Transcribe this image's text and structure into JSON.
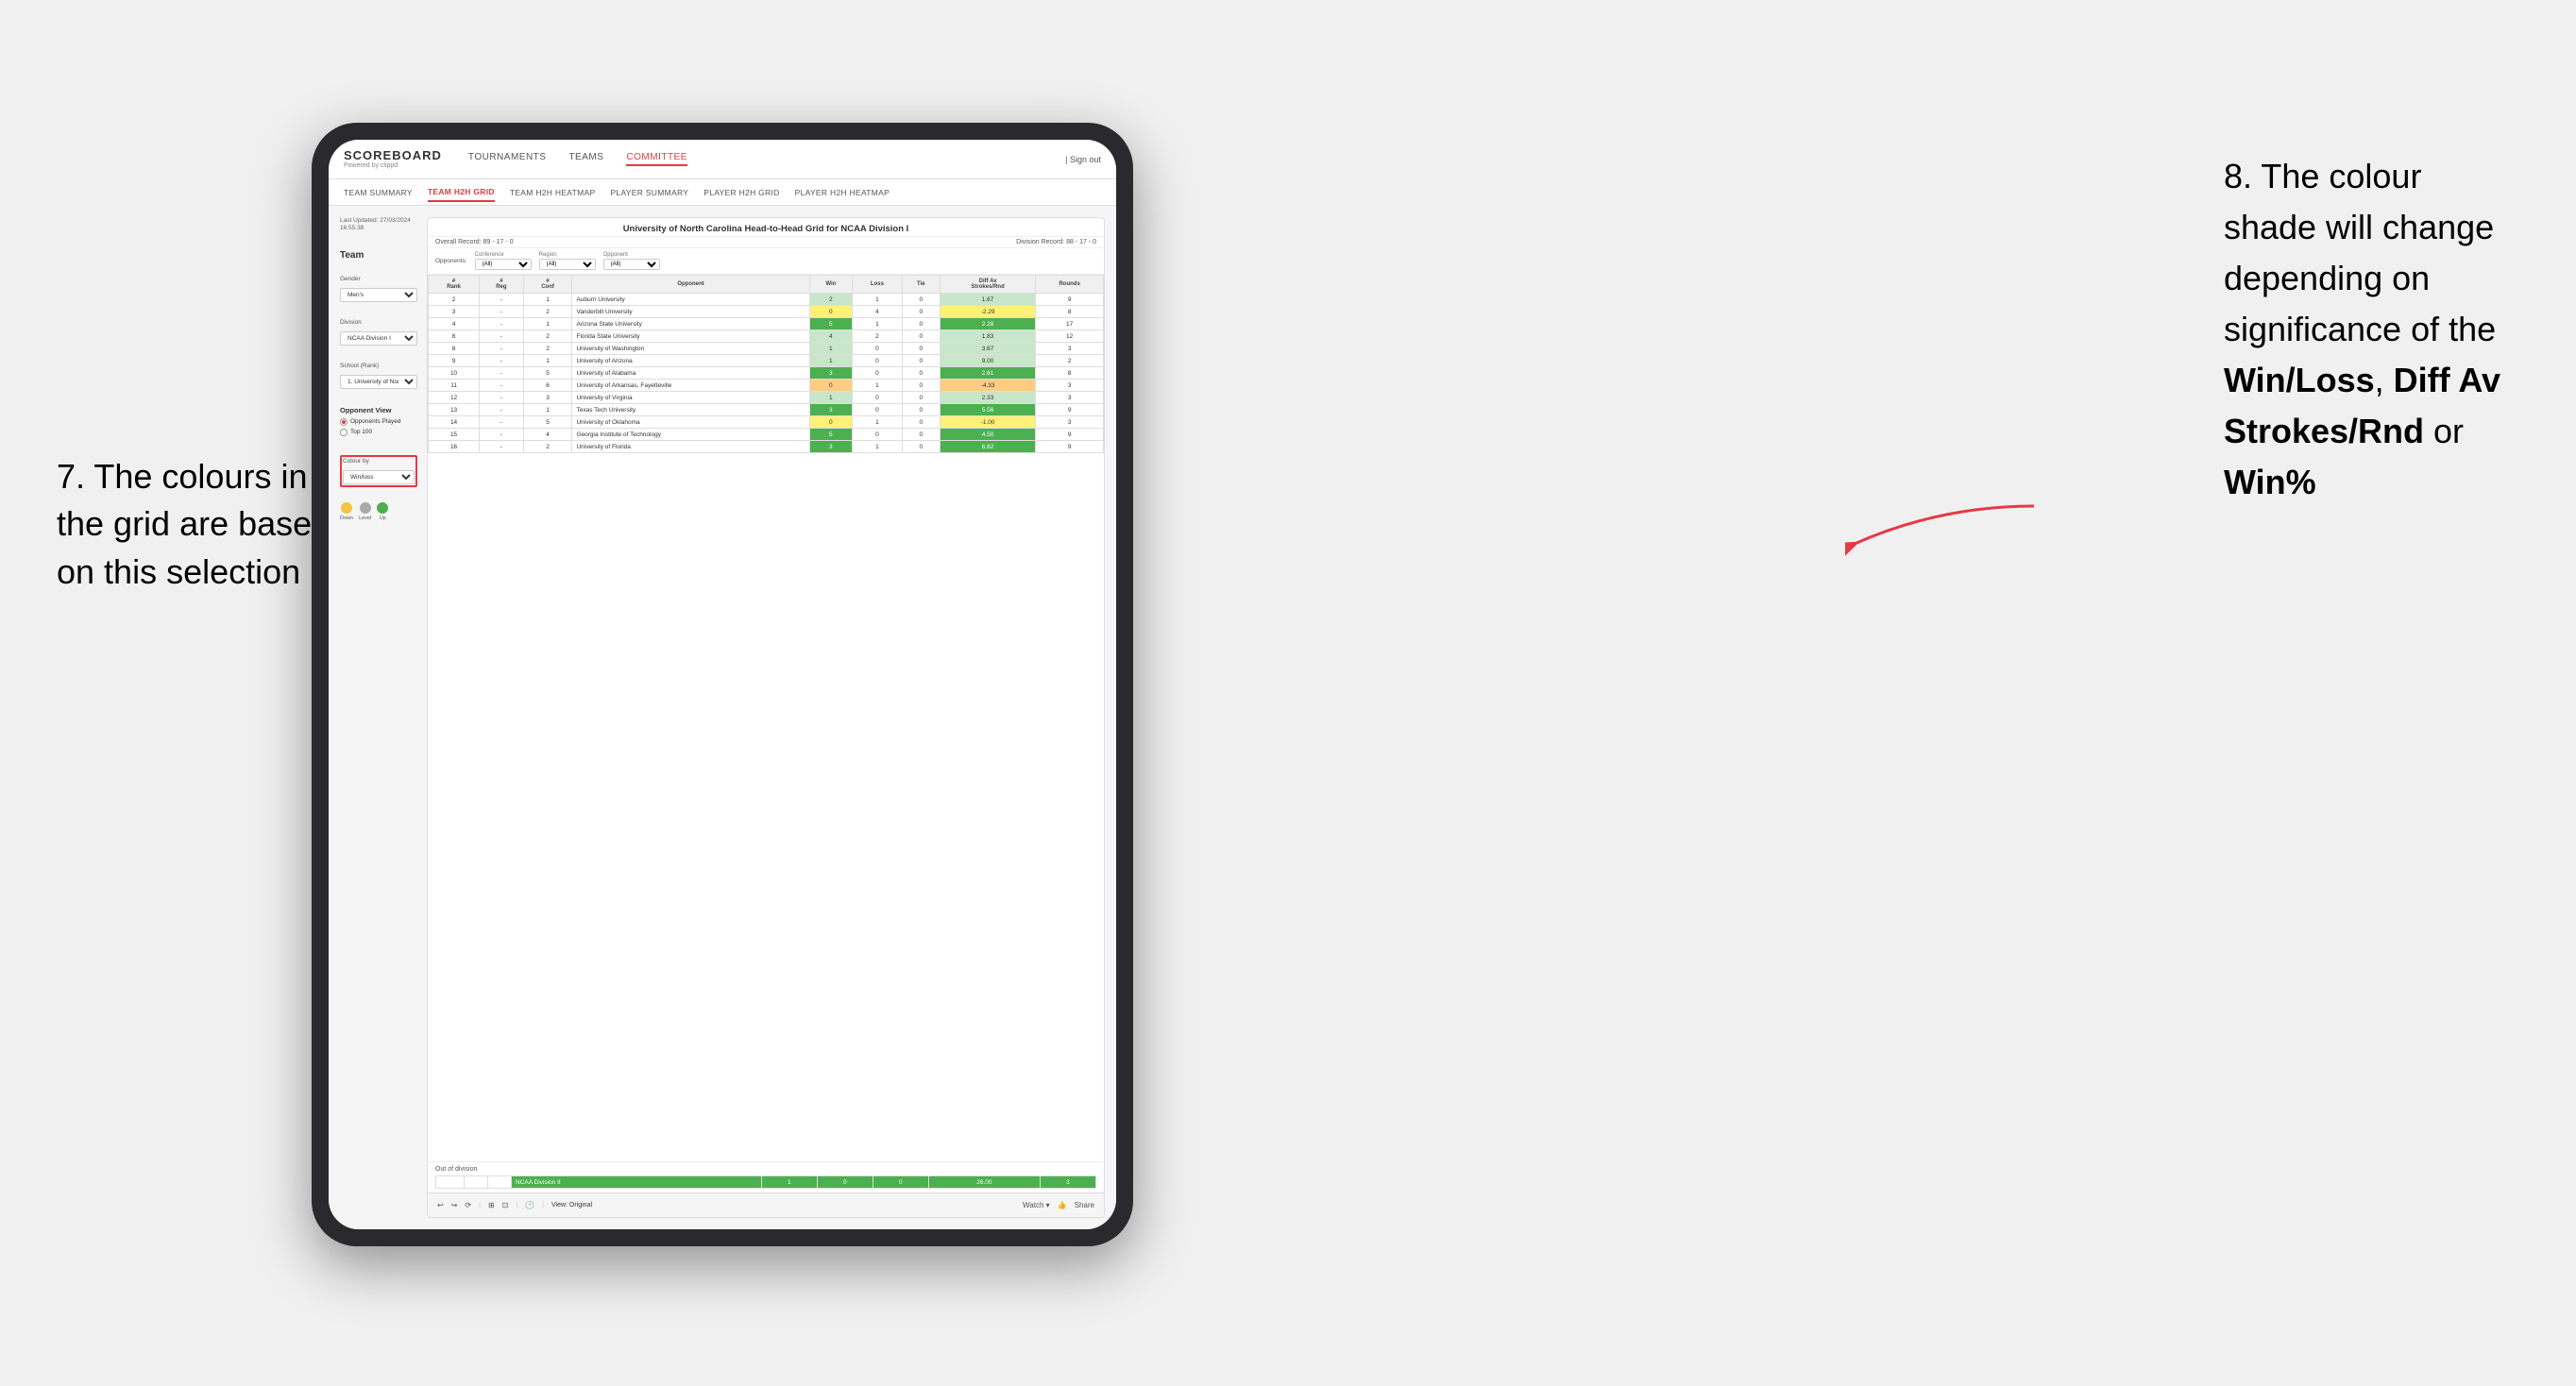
{
  "page": {
    "background": "#f0f0f0"
  },
  "annotation_left": {
    "line1": "7. The colours in",
    "line2": "the grid are based",
    "line3": "on this selection"
  },
  "annotation_right": {
    "line1": "8. The colour",
    "line2": "shade will change",
    "line3": "depending on",
    "line4": "significance of the",
    "bold1": "Win/Loss",
    "comma1": ", ",
    "bold2": "Diff Av",
    "line5": "Strokes/Rnd",
    "text5": " or",
    "bold3": "Win%"
  },
  "app": {
    "logo": "SCOREBOARD",
    "logo_sub": "Powered by clippd",
    "sign_out": "| Sign out",
    "nav": {
      "items": [
        {
          "label": "TOURNAMENTS",
          "active": false
        },
        {
          "label": "TEAMS",
          "active": false
        },
        {
          "label": "COMMITTEE",
          "active": true
        }
      ]
    },
    "sub_nav": {
      "items": [
        {
          "label": "TEAM SUMMARY",
          "active": false
        },
        {
          "label": "TEAM H2H GRID",
          "active": true
        },
        {
          "label": "TEAM H2H HEATMAP",
          "active": false
        },
        {
          "label": "PLAYER SUMMARY",
          "active": false
        },
        {
          "label": "PLAYER H2H GRID",
          "active": false
        },
        {
          "label": "PLAYER H2H HEATMAP",
          "active": false
        }
      ]
    }
  },
  "left_panel": {
    "last_updated_label": "Last Updated: 27/03/2024",
    "last_updated_time": "16:55:38",
    "team_label": "Team",
    "gender_label": "Gender",
    "gender_value": "Men's",
    "division_label": "Division",
    "division_value": "NCAA Division I",
    "school_label": "School (Rank)",
    "school_value": "1. University of Nort...",
    "opponent_view_label": "Opponent View",
    "opponents_played": "Opponents Played",
    "top_100": "Top 100",
    "colour_by_label": "Colour by",
    "colour_by_value": "Win/loss",
    "legend": {
      "down_label": "Down",
      "level_label": "Level",
      "up_label": "Up"
    }
  },
  "grid": {
    "title": "University of North Carolina Head-to-Head Grid for NCAA Division I",
    "overall_record_label": "Overall Record:",
    "overall_record": "89 - 17 - 0",
    "division_record_label": "Division Record:",
    "division_record": "88 - 17 - 0",
    "filter_opponents_label": "Opponents:",
    "filter_conf_label": "Conference",
    "filter_conf_value": "(All)",
    "filter_region_label": "Region",
    "filter_region_value": "(All)",
    "filter_opponent_label": "Opponent",
    "filter_opponent_value": "(All)",
    "columns": [
      "# Rank",
      "# Reg",
      "# Conf",
      "Opponent",
      "Win",
      "Loss",
      "Tie",
      "Diff Av Strokes/Rnd",
      "Rounds"
    ],
    "rows": [
      {
        "rank": "2",
        "reg": "-",
        "conf": "1",
        "name": "Auburn University",
        "win": "2",
        "loss": "1",
        "tie": "0",
        "diff": "1.67",
        "rounds": "9",
        "color": "light-green"
      },
      {
        "rank": "3",
        "reg": "-",
        "conf": "2",
        "name": "Vanderbilt University",
        "win": "0",
        "loss": "4",
        "tie": "0",
        "diff": "-2.29",
        "rounds": "8",
        "color": "yellow"
      },
      {
        "rank": "4",
        "reg": "-",
        "conf": "1",
        "name": "Arizona State University",
        "win": "5",
        "loss": "1",
        "tie": "0",
        "diff": "2.28",
        "rounds": "17",
        "color": "green"
      },
      {
        "rank": "6",
        "reg": "-",
        "conf": "2",
        "name": "Florida State University",
        "win": "4",
        "loss": "2",
        "tie": "0",
        "diff": "1.83",
        "rounds": "12",
        "color": "light-green"
      },
      {
        "rank": "8",
        "reg": "-",
        "conf": "2",
        "name": "University of Washington",
        "win": "1",
        "loss": "0",
        "tie": "0",
        "diff": "3.67",
        "rounds": "3",
        "color": "light-green"
      },
      {
        "rank": "9",
        "reg": "-",
        "conf": "1",
        "name": "University of Arizona",
        "win": "1",
        "loss": "0",
        "tie": "0",
        "diff": "9.00",
        "rounds": "2",
        "color": "light-green"
      },
      {
        "rank": "10",
        "reg": "-",
        "conf": "5",
        "name": "University of Alabama",
        "win": "3",
        "loss": "0",
        "tie": "0",
        "diff": "2.61",
        "rounds": "8",
        "color": "green"
      },
      {
        "rank": "11",
        "reg": "-",
        "conf": "6",
        "name": "University of Arkansas, Fayetteville",
        "win": "0",
        "loss": "1",
        "tie": "0",
        "diff": "-4.33",
        "rounds": "3",
        "color": "orange"
      },
      {
        "rank": "12",
        "reg": "-",
        "conf": "3",
        "name": "University of Virginia",
        "win": "1",
        "loss": "0",
        "tie": "0",
        "diff": "2.33",
        "rounds": "3",
        "color": "light-green"
      },
      {
        "rank": "13",
        "reg": "-",
        "conf": "1",
        "name": "Texas Tech University",
        "win": "3",
        "loss": "0",
        "tie": "0",
        "diff": "5.56",
        "rounds": "9",
        "color": "green"
      },
      {
        "rank": "14",
        "reg": "-",
        "conf": "5",
        "name": "University of Oklahoma",
        "win": "0",
        "loss": "1",
        "tie": "0",
        "diff": "-1.00",
        "rounds": "3",
        "color": "yellow"
      },
      {
        "rank": "15",
        "reg": "-",
        "conf": "4",
        "name": "Georgia Institute of Technology",
        "win": "5",
        "loss": "0",
        "tie": "0",
        "diff": "4.50",
        "rounds": "9",
        "color": "green"
      },
      {
        "rank": "16",
        "reg": "-",
        "conf": "2",
        "name": "University of Florida",
        "win": "3",
        "loss": "1",
        "tie": "0",
        "diff": "6.62",
        "rounds": "9",
        "color": "green"
      }
    ],
    "out_of_division_label": "Out of division",
    "ood_row": {
      "name": "NCAA Division II",
      "win": "1",
      "loss": "0",
      "tie": "0",
      "diff": "26.00",
      "rounds": "3",
      "color": "green"
    }
  },
  "toolbar": {
    "view_label": "View: Original",
    "watch_label": "Watch ▾",
    "share_label": "Share"
  }
}
